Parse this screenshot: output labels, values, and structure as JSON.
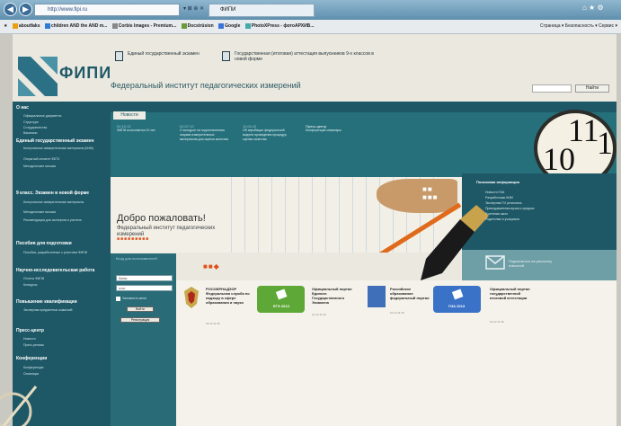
{
  "browser": {
    "address": "http://www.fipi.ru",
    "address_controls": "▾ ⊠ ⊕ ✕",
    "tab_title": "ФИПИ",
    "window_controls": "⌂ ★ ⚙",
    "favorites": [
      "aboutfaks",
      "children AND the AND m...",
      "Corbis Images - Premium...",
      "Docstrüsion",
      "Google",
      "PhotoXPress - фотоАРХИВ..."
    ],
    "tools": "Страница ▾  Безопасность ▾  Сервис ▾"
  },
  "site": {
    "logo": "ФИПИ",
    "title": "Федеральный институт педагогических измерений",
    "header_links": [
      "Единый государственный экзамен",
      "Государственная (итоговая) аттестация выпускников 9-х классов в новой форме"
    ],
    "search_button": "Найти",
    "brand_color": "#1e5866",
    "accent_color": "#e04e1a"
  },
  "sidebar": [
    {
      "title": "О нас",
      "items": [
        "Официальные документы",
        "Структура",
        "Сотрудничество",
        "Вакансии"
      ]
    },
    {
      "title": "Единый государственный экзамен",
      "items": [
        "Контрольные измерительные материалы (КИМ)",
        "Открытый сегмент ФБТЗ",
        "Методические письма"
      ]
    },
    {
      "title": "9 класс. Экзамен в новой форме",
      "items": [
        "Контрольные измерительные материалы",
        "Методические письма",
        "Рекомендации для экспертов и учителя"
      ]
    },
    {
      "title": "Пособия для подготовки",
      "items": [
        "Пособия, разработанные с участием ФИПИ"
      ]
    },
    {
      "title": "Научно-исследовательская работа",
      "items": [
        "Отчеты ФИПИ",
        "Конкурсы"
      ]
    },
    {
      "title": "Повышение квалификации",
      "items": [
        "Экспертам предметных комиссий"
      ]
    },
    {
      "title": "Пресс-центр",
      "items": [
        "Новости",
        "Пресс-релизы"
      ]
    },
    {
      "title": "Конференции",
      "items": [
        "Конференции",
        "Семинары"
      ]
    }
  ],
  "news": {
    "tab": "Новости",
    "items": [
      {
        "date": "01.10.12",
        "text": "ФИПИ исполняется 10 лет"
      },
      {
        "date": "01.07.12",
        "text": "О конкурсе на подготовленных лицами измерительных материалов для оценки качества"
      },
      {
        "date": "11.04.12",
        "text": "Об апробации федеральной модели проведения процедур оценки качества"
      }
    ],
    "press_title": "Пресс-центр",
    "press_text": "Конференции семинары"
  },
  "hero": {
    "welcome": "Добро пожаловать!",
    "subtitle": "Федеральный институт педагогических измерений"
  },
  "search_panel": {
    "title": "Поисковая информация",
    "items": [
      "Новости ГИА",
      "Разработчики КИМ",
      "Экспертам ГИ региональ",
      "Преподавателям вузов и средних",
      "Учителям школ",
      "Родителям и учащимся"
    ]
  },
  "login": {
    "title": "Вход для пользователей",
    "login_value": "Логин",
    "password_value": "••••••",
    "remember": "Запомнить меня",
    "enter_button": "Войти",
    "register_button": "Регистрация"
  },
  "mail": {
    "text": "Подписаться на рассылку новостей"
  },
  "cards": [
    {
      "badge": "",
      "title": "РОСОБРНАДЗОР Федеральная служба по надзору в сфере образования и науки",
      "meta": "16.12.11  09"
    },
    {
      "badge": "ЕГЭ 2013",
      "title": "Официальный портал Единого Государственного Экзамена",
      "meta": "10.12.11  09"
    },
    {
      "badge": "",
      "title": "Российское образование федеральный портал",
      "meta": "10.12.11  09"
    },
    {
      "badge": "ГИА 2013",
      "title": "Официальный портал государственной итоговой аттестации",
      "meta": "10.12.11  09"
    }
  ]
}
